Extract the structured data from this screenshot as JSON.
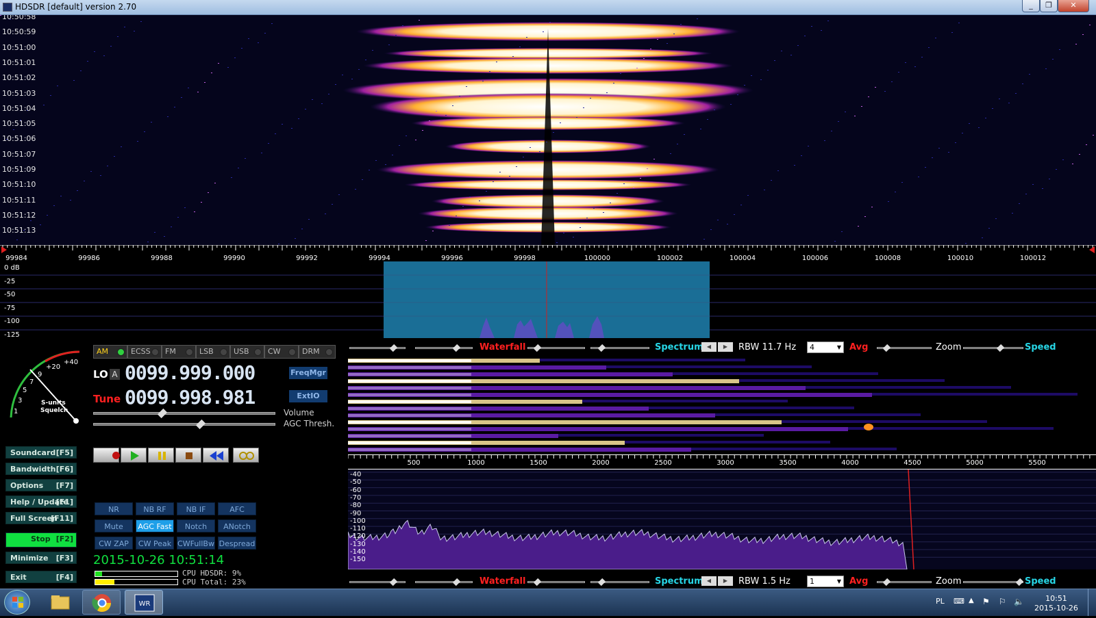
{
  "window": {
    "title": "HDSDR [default]  version 2.70",
    "min": "_",
    "max": "❐",
    "close": "✕"
  },
  "waterfall": {
    "times": [
      "10:50:58",
      "10:50:59",
      "10:51:00",
      "10:51:01",
      "10:51:02",
      "10:51:03",
      "10:51:04",
      "10:51:05",
      "10:51:06",
      "10:51:07",
      "10:51:09",
      "10:51:10",
      "10:51:11",
      "10:51:12",
      "10:51:13"
    ]
  },
  "freq_scale": {
    "ticks": [
      "99984",
      "99986",
      "99988",
      "99990",
      "99992",
      "99994",
      "99996",
      "99998",
      "100000",
      "100002",
      "100004",
      "100006",
      "100008",
      "100010",
      "100012"
    ]
  },
  "spectrum": {
    "db_labels": [
      "0 dB",
      "-25",
      "-50",
      "-75",
      "-100",
      "-125"
    ]
  },
  "modes": [
    {
      "label": "AM",
      "active": true
    },
    {
      "label": "ECSS",
      "active": false
    },
    {
      "label": "FM",
      "active": false
    },
    {
      "label": "LSB",
      "active": false
    },
    {
      "label": "USB",
      "active": false
    },
    {
      "label": "CW",
      "active": false
    },
    {
      "label": "DRM",
      "active": false
    }
  ],
  "lo": {
    "label": "LO",
    "sub": "A",
    "value": "0099.999.000"
  },
  "tune": {
    "label": "Tune",
    "value": "0099.998.981"
  },
  "freqmgr": "FreqMgr",
  "extio": "ExtIO",
  "volume_label": "Volume",
  "agc_thresh_label": "AGC Thresh.",
  "smeter": {
    "labels": [
      "1",
      "3",
      "5",
      "7",
      "9",
      "+20",
      "+40"
    ],
    "caption1": "S-units",
    "caption2": "Squelch"
  },
  "side_buttons": [
    {
      "label": "Soundcard",
      "key": "[F5]"
    },
    {
      "label": "Bandwidth",
      "key": "[F6]"
    },
    {
      "label": "Options",
      "key": "[F7]"
    },
    {
      "label": "Help / Update",
      "key": "[F1]"
    },
    {
      "label": "Full Screen",
      "key": "[F11]"
    },
    {
      "label": "Stop",
      "key": "[F2]"
    },
    {
      "label": "Minimize",
      "key": "[F3]"
    },
    {
      "label": "Exit",
      "key": "[F4]"
    }
  ],
  "dsp_buttons": [
    [
      "NR",
      "NB RF",
      "NB IF",
      "AFC"
    ],
    [
      "Mute",
      "AGC Fast",
      "Notch",
      "ANotch"
    ],
    [
      "CW ZAP",
      "CW Peak",
      "CWFullBw",
      "Despread"
    ]
  ],
  "datetime": "2015-10-26 10:51:14",
  "cpu_hdsdr": "CPU HDSDR: 9%",
  "cpu_total": "CPU Total: 23%",
  "rf_ctrl": {
    "waterfall": "Waterfall",
    "spectrum": "Spectrum",
    "rbw": "RBW 11.7 Hz",
    "avg_value": "4",
    "avg": "Avg",
    "zoom": "Zoom",
    "speed": "Speed"
  },
  "af_ctrl": {
    "waterfall": "Waterfall",
    "spectrum": "Spectrum",
    "rbw": "RBW  1.5 Hz",
    "avg_value": "1",
    "avg": "Avg",
    "zoom": "Zoom",
    "speed": "Speed"
  },
  "af_scale": {
    "ticks": [
      "500",
      "1000",
      "1500",
      "2000",
      "2500",
      "3000",
      "3500",
      "4000",
      "4500",
      "5000",
      "5500"
    ]
  },
  "af_db": [
    "-40",
    "-50",
    "-60",
    "-70",
    "-80",
    "-90",
    "-100",
    "-110",
    "-120",
    "-130",
    "-140",
    "-150"
  ],
  "taskbar": {
    "lang": "PL",
    "time": "10:51",
    "date": "2015-10-26"
  },
  "colors": {
    "passband": "#1a6e96",
    "accent_cyan": "#27d6e6",
    "accent_red": "#ff2020",
    "led_green": "#30d040",
    "stop_green": "#10e040"
  }
}
